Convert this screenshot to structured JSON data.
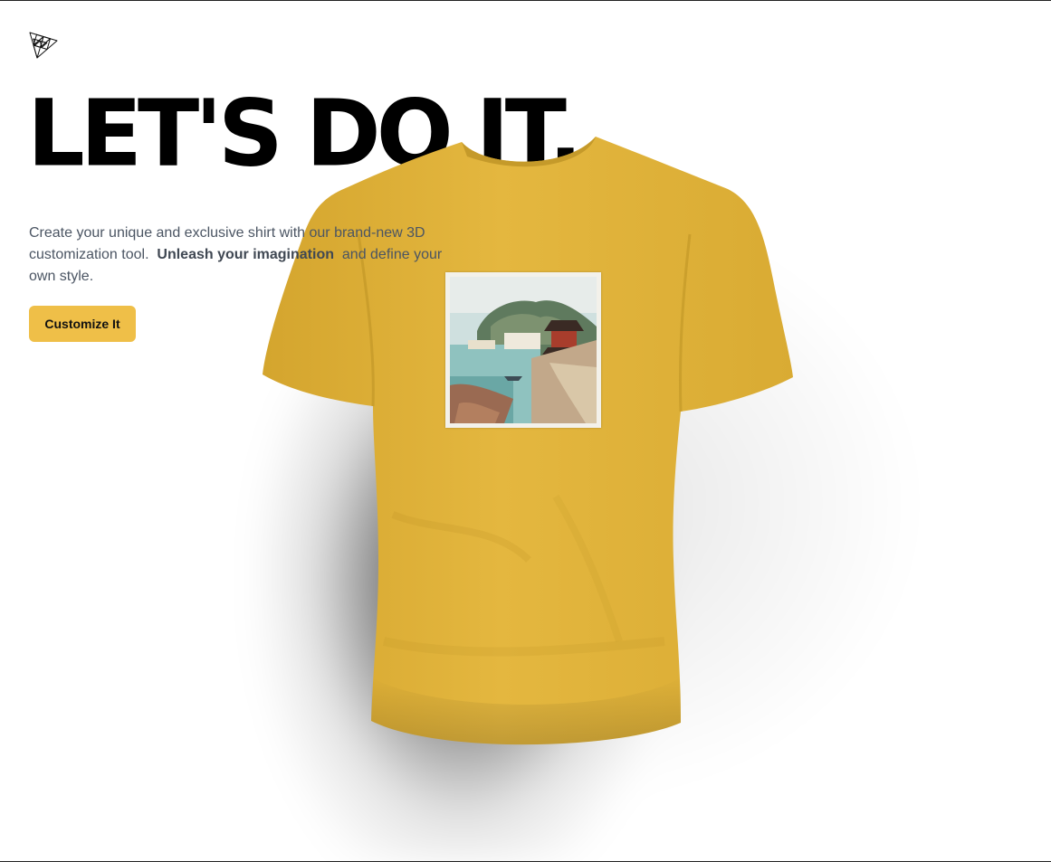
{
  "brand": {
    "logo_icon": "threejs-triangle-icon"
  },
  "hero": {
    "headline": "LET'S DO IT.",
    "description_before": "Create your unique and exclusive shirt with our brand-new 3D customization tool.",
    "description_emphasis": "Unleash your imagination",
    "description_after": "and define your own style.",
    "cta_label": "Customize It"
  },
  "product": {
    "shirt_color": "#e0b33c",
    "decal_icon": "painting-decal-image"
  },
  "colors": {
    "accent": "#efbf48",
    "text_primary": "#000000",
    "text_muted": "#4b5563"
  }
}
